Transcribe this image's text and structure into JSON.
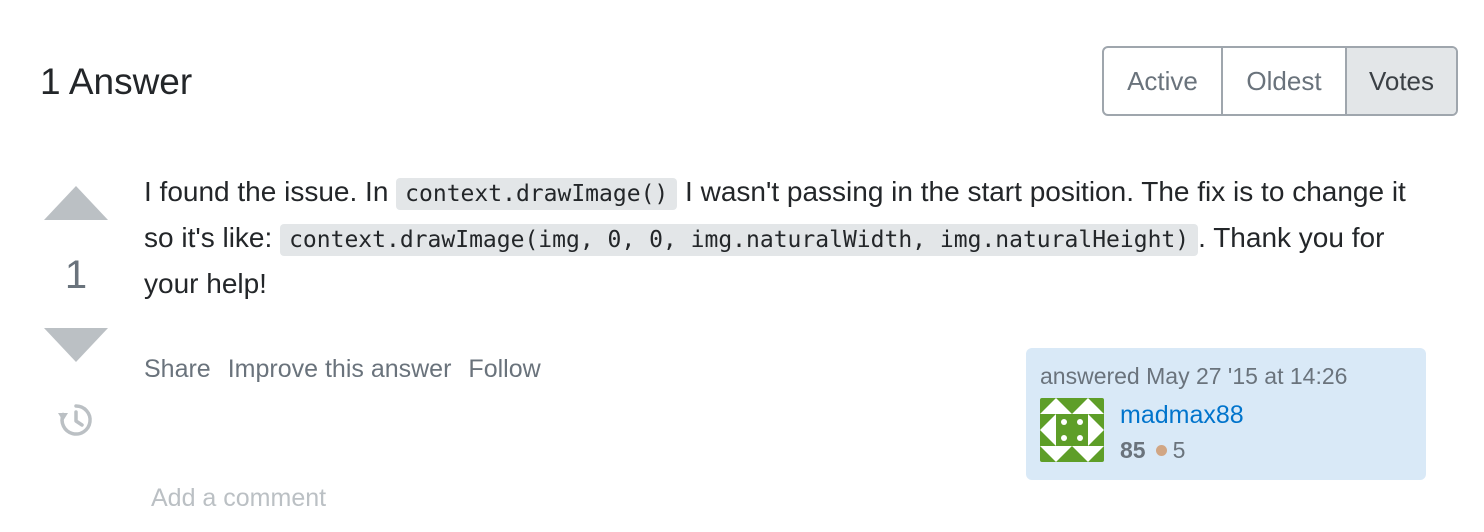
{
  "header": {
    "title": "1 Answer"
  },
  "sort": {
    "options": [
      "Active",
      "Oldest",
      "Votes"
    ],
    "selected": "Votes"
  },
  "answer": {
    "votes": "1",
    "body": {
      "text1": "I found the issue. In ",
      "code1": "context.drawImage()",
      "text2": " I wasn't passing in the start position. The fix is to change it so it's like: ",
      "code2": "context.drawImage(img, 0, 0, img.naturalWidth, img.naturalHeight)",
      "text3": ". Thank you for your help!"
    },
    "menu": {
      "share": "Share",
      "improve": "Improve this answer",
      "follow": "Follow"
    },
    "user": {
      "action_time": "answered May 27 '15 at 14:26",
      "name": "madmax88",
      "reputation": "85",
      "bronze_badges": "5",
      "avatar_icon": "identicon-avatar"
    },
    "add_comment": "Add a comment"
  },
  "colors": {
    "link": "#0074cc",
    "user_card_bg": "#d9e9f7",
    "code_bg": "#e3e6e8",
    "vote_arrow": "#bbc0c4",
    "bronze": "#d1a684",
    "avatar_green": "#5e9e28"
  }
}
